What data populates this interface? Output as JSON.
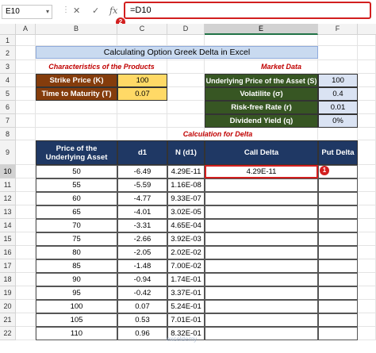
{
  "formula_bar": {
    "name_box": "E10",
    "formula": "=D10",
    "callout_number": "2"
  },
  "columns": [
    "A",
    "B",
    "C",
    "D",
    "E",
    "F"
  ],
  "rows": [
    "1",
    "2",
    "3",
    "4",
    "5",
    "6",
    "7",
    "8",
    "9",
    "10",
    "11",
    "12",
    "13",
    "14",
    "15",
    "16",
    "17",
    "18",
    "19",
    "20",
    "21",
    "22"
  ],
  "sheet": {
    "title": "Calculating Option Greek Delta in Excel",
    "products_header": "Characteristics of the Products",
    "market_header": "Market Data",
    "products": [
      {
        "label": "Strike Price (K)",
        "value": "100"
      },
      {
        "label": "Time to Maturity (T)",
        "value": "0.07"
      }
    ],
    "market": [
      {
        "label": "Underlying Price of the Asset (S)",
        "value": "100"
      },
      {
        "label": "Volatilite (σ)",
        "value": "0.4"
      },
      {
        "label": "Risk-free Rate (r)",
        "value": "0.01"
      },
      {
        "label": "Dividend Yield (q)",
        "value": "0%"
      }
    ],
    "calc_header": "Calculation for Delta",
    "table_headers": [
      "Price of the Underlying Asset",
      "d1",
      "N (d1)",
      "Call Delta",
      "Put Delta"
    ],
    "table_rows": [
      {
        "price": "50",
        "d1": "-6.49",
        "nd1": "4.29E-11",
        "call": "4.29E-11",
        "put": ""
      },
      {
        "price": "55",
        "d1": "-5.59",
        "nd1": "1.16E-08",
        "call": "",
        "put": ""
      },
      {
        "price": "60",
        "d1": "-4.77",
        "nd1": "9.33E-07",
        "call": "",
        "put": ""
      },
      {
        "price": "65",
        "d1": "-4.01",
        "nd1": "3.02E-05",
        "call": "",
        "put": ""
      },
      {
        "price": "70",
        "d1": "-3.31",
        "nd1": "4.65E-04",
        "call": "",
        "put": ""
      },
      {
        "price": "75",
        "d1": "-2.66",
        "nd1": "3.92E-03",
        "call": "",
        "put": ""
      },
      {
        "price": "80",
        "d1": "-2.05",
        "nd1": "2.02E-02",
        "call": "",
        "put": ""
      },
      {
        "price": "85",
        "d1": "-1.48",
        "nd1": "7.00E-02",
        "call": "",
        "put": ""
      },
      {
        "price": "90",
        "d1": "-0.94",
        "nd1": "1.74E-01",
        "call": "",
        "put": ""
      },
      {
        "price": "95",
        "d1": "-0.42",
        "nd1": "3.37E-01",
        "call": "",
        "put": ""
      },
      {
        "price": "100",
        "d1": "0.07",
        "nd1": "5.24E-01",
        "call": "",
        "put": ""
      },
      {
        "price": "105",
        "d1": "0.53",
        "nd1": "7.01E-01",
        "call": "",
        "put": ""
      },
      {
        "price": "110",
        "d1": "0.96",
        "nd1": "8.32E-01",
        "call": "",
        "put": ""
      }
    ],
    "callout_number": "1"
  },
  "watermark": "exceldemy",
  "colors": {
    "accent_red": "#d21f1f",
    "excel_green": "#217346",
    "navy": "#1f3864",
    "brown": "#843c0c",
    "dark_green": "#375623"
  }
}
